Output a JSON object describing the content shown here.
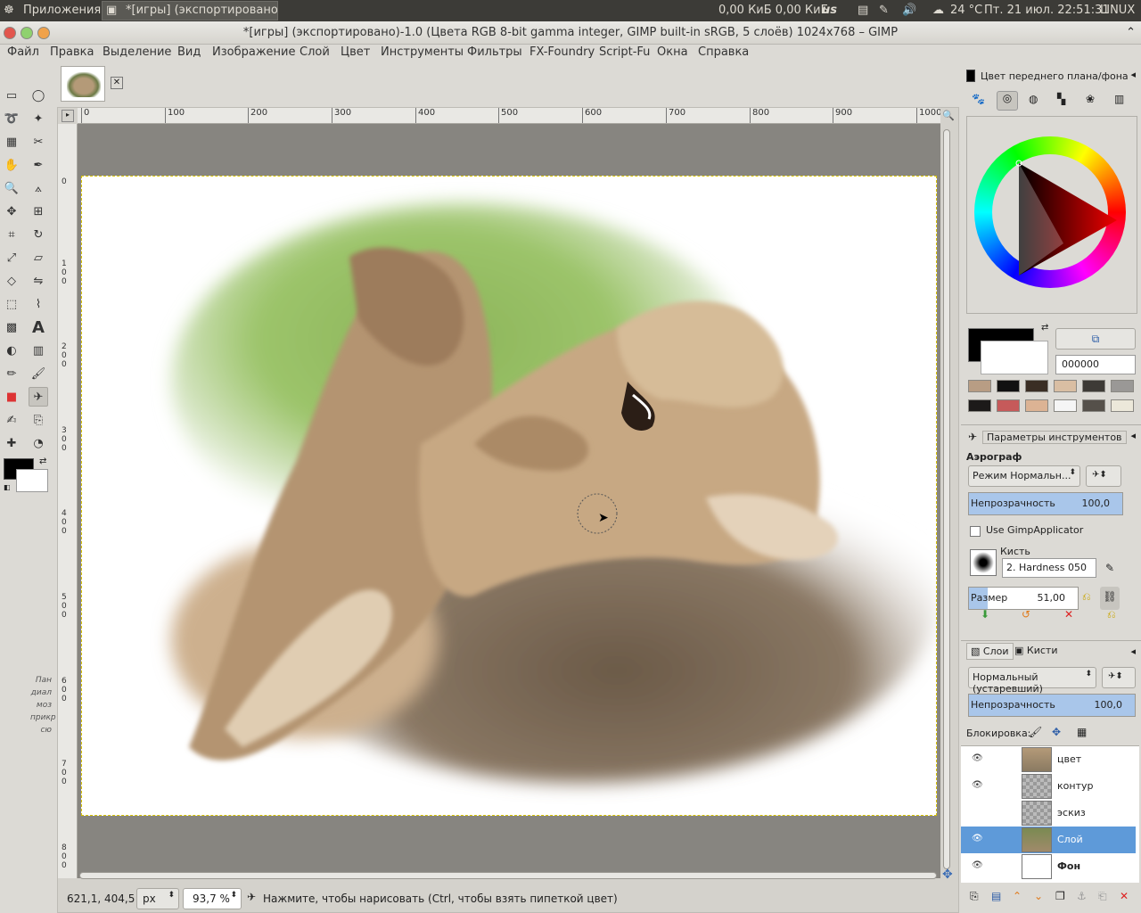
{
  "panel": {
    "apps_label": "Приложения",
    "task_label": "*[игры] (экспортировано)-...",
    "netspeed": "0,00 КиБ 0,00 КиБ",
    "kbd": "us",
    "weather": "24 °C",
    "datetime": "Пт. 21 июл. 22:51:31",
    "user": "LINUX"
  },
  "window": {
    "title": "*[игры] (экспортировано)-1.0 (Цвета RGB 8-bit gamma integer, GIMP built-in sRGB, 5 слоёв) 1024x768 – GIMP"
  },
  "menu": [
    "Файл",
    "Правка",
    "Выделение",
    "Вид",
    "Изображение",
    "Слой",
    "Цвет",
    "Инструменты",
    "Фильтры",
    "FX-Foundry",
    "Script-Fu",
    "Окна",
    "Справка"
  ],
  "ruler": {
    "h": [
      "0",
      "100",
      "200",
      "300",
      "400",
      "500",
      "600",
      "700",
      "800",
      "900",
      "1000"
    ],
    "v": [
      "0",
      "100",
      "200",
      "300",
      "400",
      "500",
      "600",
      "700",
      "800"
    ]
  },
  "toolbox_hint": [
    "Пан",
    "диал",
    "моз",
    "прикр",
    "сю"
  ],
  "status": {
    "coords": "621,1, 404,5",
    "unit": "px",
    "zoom": "93,7 %",
    "message": "Нажмите, чтобы нарисовать (Ctrl, чтобы взять пипеткой цвет)"
  },
  "fg_panel": {
    "title": "Цвет переднего плана/фона",
    "hex": "000000",
    "swatches": [
      "#b89d84",
      "#111111",
      "#3a2e24",
      "#d9bea3",
      "#3d3a36",
      "#9a9896",
      "#1c1a19",
      "#c65a5a",
      "#dcb394",
      "#f5f5f5",
      "#55504a",
      "#ece8da"
    ]
  },
  "tool_options": {
    "title": "Параметры инструментов",
    "tool": "Аэрограф",
    "mode": "Режим Нормальн...",
    "opacity_label": "Непрозрачность",
    "opacity": "100,0",
    "applicator": "Use GimpApplicator",
    "brush_label": "Кисть",
    "brush": "2. Hardness 050",
    "size_label": "Размер",
    "size": "51,00"
  },
  "layers_panel": {
    "tab_layers": "Слои",
    "tab_brushes": "Кисти",
    "mode": "Нормальный (устаревший)",
    "opacity_label": "Непрозрачность",
    "opacity": "100,0",
    "lock_label": "Блокировка:",
    "layers": [
      {
        "name": "цвет",
        "selected": false
      },
      {
        "name": "контур",
        "selected": false
      },
      {
        "name": "эскиз",
        "selected": false
      },
      {
        "name": "Слой",
        "selected": true
      },
      {
        "name": "Фон",
        "selected": false
      }
    ]
  },
  "colors": {
    "accent": "#5e9ad9",
    "panel_bg": "#3c3b37",
    "fg": "#000000",
    "bg": "#ffffff"
  }
}
